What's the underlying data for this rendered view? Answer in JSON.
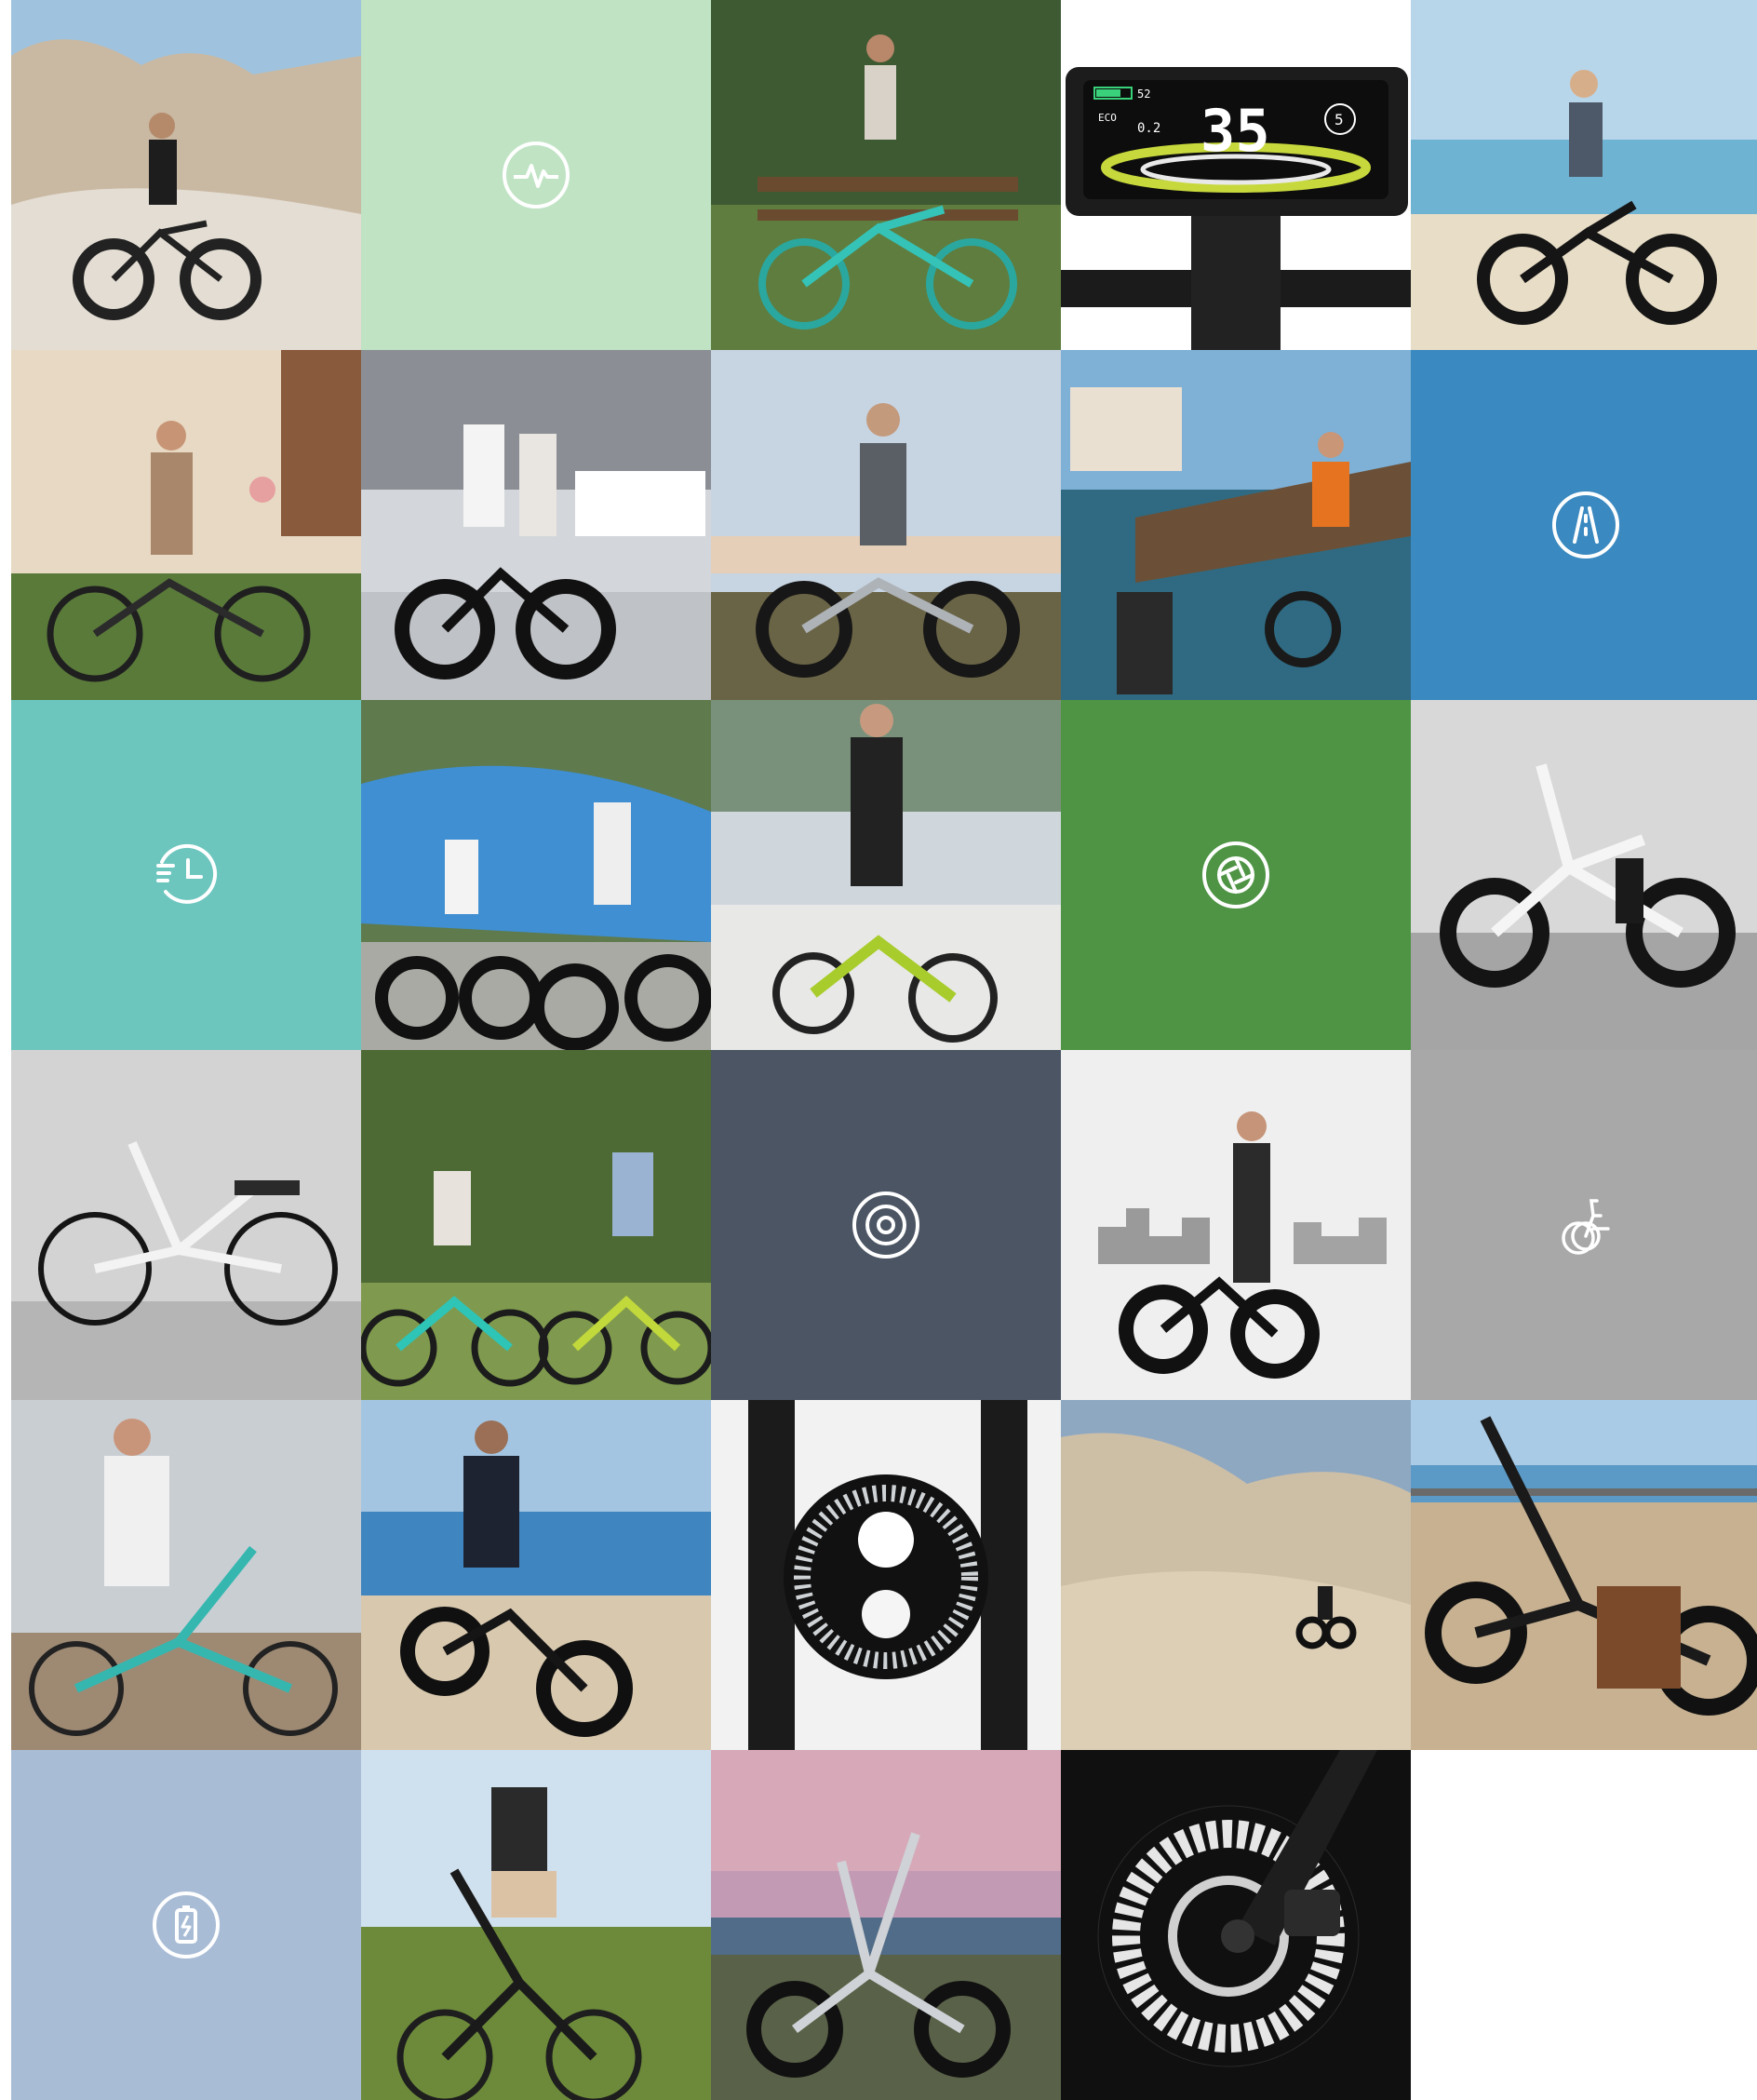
{
  "grid": {
    "columns": 5,
    "rows": 6,
    "icon_tile_colors": {
      "pulse": "#bfe3c3",
      "road": "#3a89c0",
      "clock": "#6cc6be",
      "aperture": "#4e9444",
      "target": "#4b5563",
      "folding_bike": "#a8a8a8",
      "battery": "#a9bcd6"
    }
  },
  "display": {
    "battery_level": "52",
    "speed": "35",
    "trip": "0.2",
    "assist_level": "5",
    "eco_label": "ECO"
  },
  "icons": {
    "pulse": "pulse-icon",
    "road": "road-icon",
    "clock": "clock-reverse-icon",
    "aperture": "aperture-icon",
    "target": "target-icon",
    "folding_bike": "folding-bike-icon",
    "battery": "battery-charge-icon"
  }
}
